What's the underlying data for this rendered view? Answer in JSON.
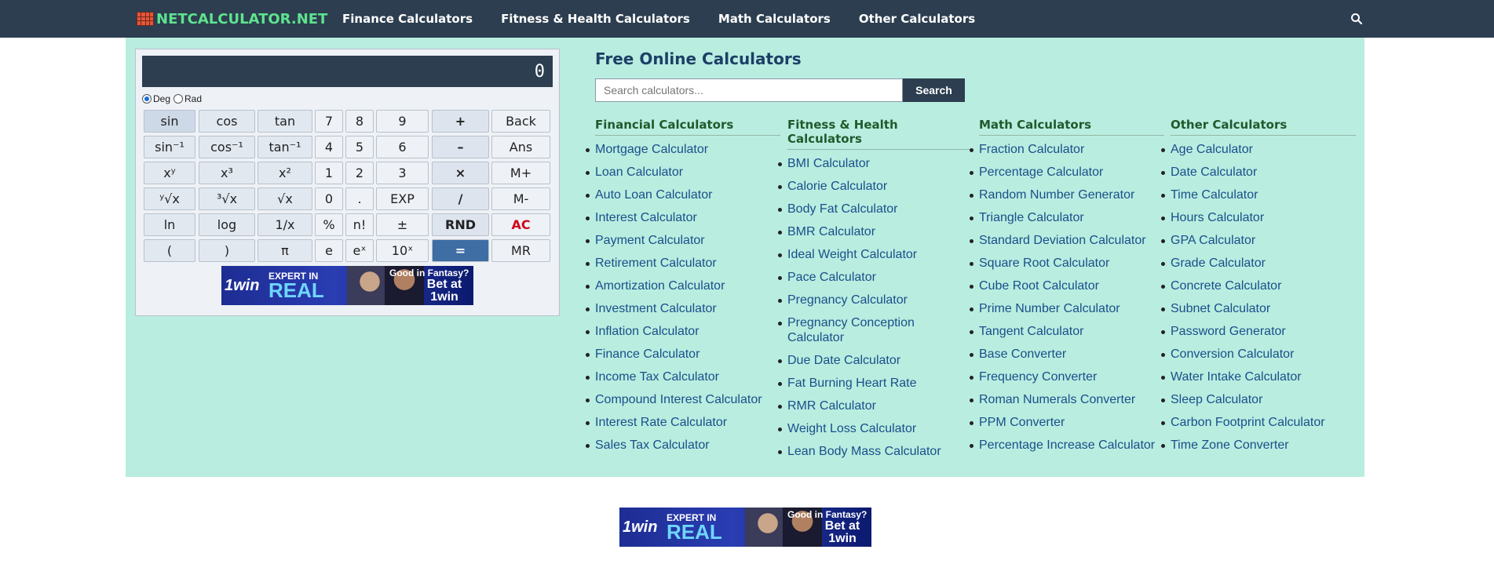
{
  "nav": {
    "logo": "NETCALCULATOR.NET",
    "links": [
      "Finance Calculators",
      "Fitness & Health Calculators",
      "Math Calculators",
      "Other Calculators"
    ]
  },
  "calculator": {
    "display": "0",
    "modes": {
      "deg": "Deg",
      "rad": "Rad",
      "selected": "Deg"
    },
    "keys": [
      [
        "sin",
        "cos",
        "tan",
        "7",
        "8",
        "9",
        "+",
        "Back"
      ],
      [
        "sin⁻¹",
        "cos⁻¹",
        "tan⁻¹",
        "4",
        "5",
        "6",
        "–",
        "Ans"
      ],
      [
        "xʸ",
        "x³",
        "x²",
        "1",
        "2",
        "3",
        "×",
        "M+"
      ],
      [
        "ʸ√x",
        "³√x",
        "√x",
        "0",
        ".",
        "EXP",
        "/",
        "M-"
      ],
      [
        "ln",
        "log",
        "1/x",
        "%",
        "n!",
        "±",
        "RND",
        "AC"
      ],
      [
        "(",
        ")",
        "π",
        "e",
        "eˣ",
        "10ˣ",
        "=",
        "MR"
      ]
    ]
  },
  "ad": {
    "brand": "1win",
    "line1": "EXPERT IN",
    "line2": "REAL",
    "line3": "Good in Fantasy?",
    "line4": "Bet at 1win"
  },
  "main": {
    "title": "Free Online Calculators",
    "search_placeholder": "Search calculators...",
    "search_button": "Search",
    "columns": [
      {
        "heading": "Financial Calculators",
        "items": [
          "Mortgage Calculator",
          "Loan Calculator",
          "Auto Loan Calculator",
          "Interest Calculator",
          "Payment Calculator",
          "Retirement Calculator",
          "Amortization Calculator",
          "Investment Calculator",
          "Inflation Calculator",
          "Finance Calculator",
          "Income Tax Calculator",
          "Compound Interest Calculator",
          "Interest Rate Calculator",
          "Sales Tax Calculator"
        ]
      },
      {
        "heading": "Fitness & Health Calculators",
        "items": [
          "BMI Calculator",
          "Calorie Calculator",
          "Body Fat Calculator",
          "BMR Calculator",
          "Ideal Weight Calculator",
          "Pace Calculator",
          "Pregnancy Calculator",
          "Pregnancy Conception Calculator",
          "Due Date Calculator",
          "Fat Burning Heart Rate",
          "RMR Calculator",
          "Weight Loss Calculator",
          "Lean Body Mass Calculator"
        ]
      },
      {
        "heading": "Math Calculators",
        "items": [
          "Fraction Calculator",
          "Percentage Calculator",
          "Random Number Generator",
          "Triangle Calculator",
          "Standard Deviation Calculator",
          "Square Root Calculator",
          "Cube Root Calculator",
          "Prime Number Calculator",
          "Tangent Calculator",
          "Base Converter",
          "Frequency Converter",
          "Roman Numerals Converter",
          "PPM Converter",
          "Percentage Increase Calculator"
        ]
      },
      {
        "heading": "Other Calculators",
        "items": [
          "Age Calculator",
          "Date Calculator",
          "Time Calculator",
          "Hours Calculator",
          "GPA Calculator",
          "Grade Calculator",
          "Concrete Calculator",
          "Subnet Calculator",
          "Password Generator",
          "Conversion Calculator",
          "Water Intake Calculator",
          "Sleep Calculator",
          "Carbon Footprint Calculator",
          "Time Zone Converter"
        ]
      }
    ]
  },
  "colors": {
    "nav_bg": "#2c3e50",
    "logo": "#5ee38e",
    "panel_bg": "#b9ede0",
    "link": "#1a4f8a",
    "heading": "#1f5a2c",
    "equals_key": "#3e6ea3",
    "ac_key": "#d0021b"
  }
}
